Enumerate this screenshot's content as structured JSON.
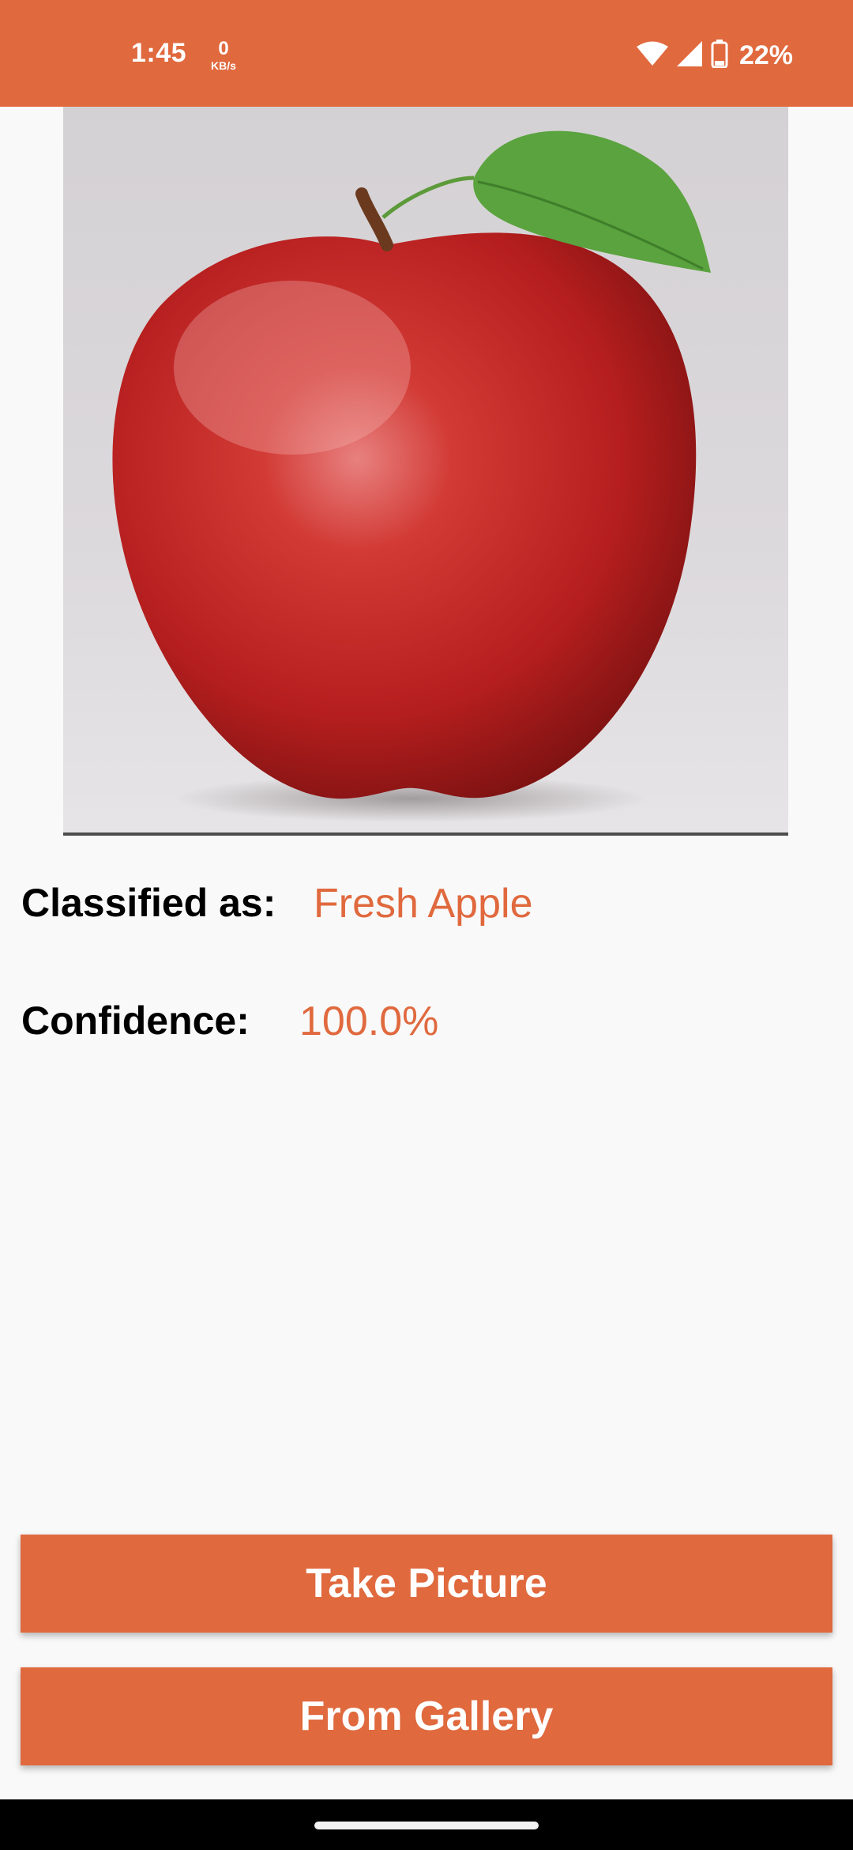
{
  "status_bar": {
    "time": "1:45",
    "net_speed_value": "0",
    "net_speed_unit": "KB/s",
    "battery_percent": "22%",
    "icons": [
      "wifi-icon",
      "cell-signal-icon",
      "battery-icon"
    ]
  },
  "image": {
    "subject": "apple-photo"
  },
  "result": {
    "classified_label": "Classified as:",
    "classified_value": "Fresh Apple",
    "confidence_label": "Confidence:",
    "confidence_value": "100.0%"
  },
  "buttons": {
    "take_picture": "Take Picture",
    "from_gallery": "From Gallery"
  },
  "colors": {
    "accent": "#e0693e",
    "background": "#f9f9f9"
  }
}
